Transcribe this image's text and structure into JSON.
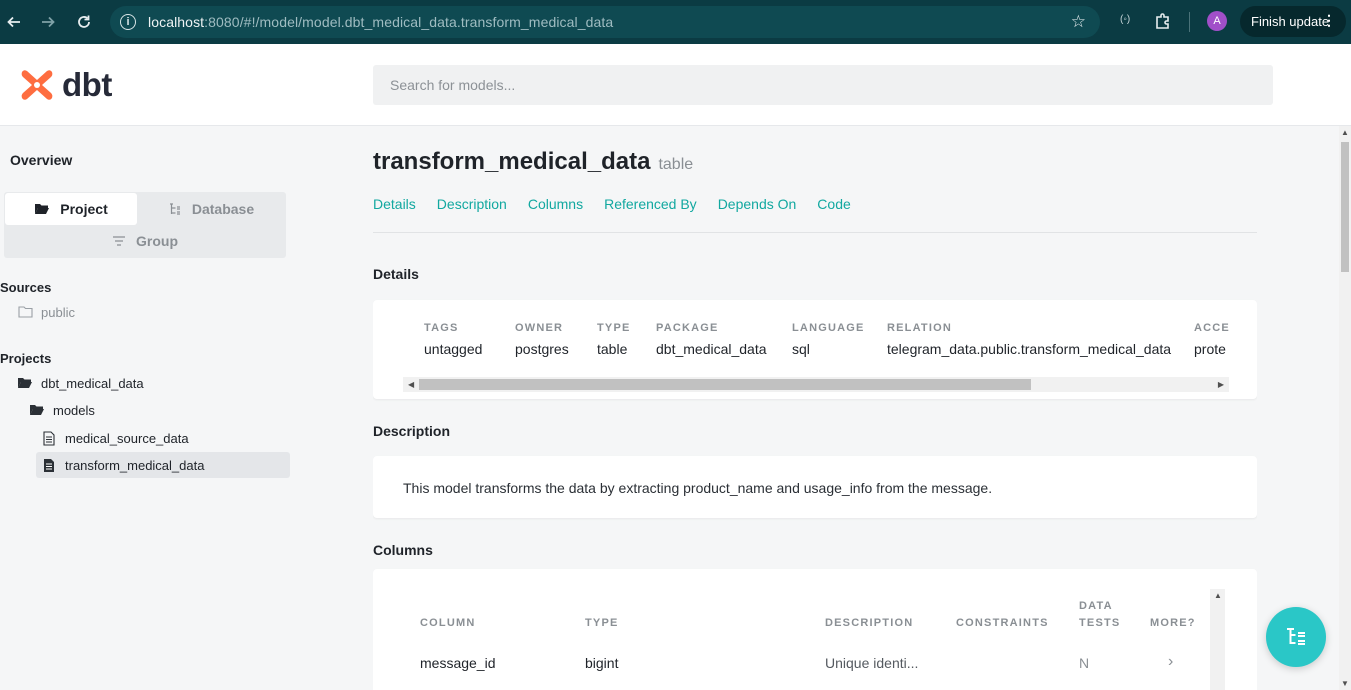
{
  "browser": {
    "url_host": "localhost",
    "url_rest": ":8080/#!/model/model.dbt_medical_data.transform_medical_data",
    "avatar_letter": "A",
    "finish_update_label": "Finish update"
  },
  "header": {
    "logo_text": "dbt",
    "search_placeholder": "Search for models..."
  },
  "sidebar": {
    "overview_label": "Overview",
    "tabs": [
      {
        "label": "Project",
        "active": true
      },
      {
        "label": "Database",
        "active": false
      },
      {
        "label": "Group",
        "active": false
      }
    ],
    "sources_label": "Sources",
    "sources": [
      {
        "label": "public"
      }
    ],
    "projects_label": "Projects",
    "project_tree": [
      {
        "label": "dbt_medical_data",
        "kind": "folder-open"
      },
      {
        "label": "models",
        "kind": "folder-open"
      },
      {
        "label": "medical_source_data",
        "kind": "file"
      },
      {
        "label": "transform_medical_data",
        "kind": "file",
        "selected": true
      }
    ]
  },
  "main": {
    "title": "transform_medical_data",
    "subtitle": "table",
    "nav_links": [
      "Details",
      "Description",
      "Columns",
      "Referenced By",
      "Depends On",
      "Code"
    ],
    "details_heading": "Details",
    "details": [
      {
        "key": "TAGS",
        "value": "untagged"
      },
      {
        "key": "OWNER",
        "value": "postgres"
      },
      {
        "key": "TYPE",
        "value": "table"
      },
      {
        "key": "PACKAGE",
        "value": "dbt_medical_data"
      },
      {
        "key": "LANGUAGE",
        "value": "sql"
      },
      {
        "key": "RELATION",
        "value": "telegram_data.public.transform_medical_data"
      },
      {
        "key": "ACCES",
        "value": "prote"
      }
    ],
    "description_heading": "Description",
    "description_text": "This model transforms the data by extracting product_name and usage_info from the message.",
    "columns_heading": "Columns",
    "columns_headers": [
      "COLUMN",
      "TYPE",
      "DESCRIPTION",
      "CONSTRAINTS",
      "DATA",
      "TESTS",
      "MORE?"
    ],
    "columns_rows": [
      {
        "column": "message_id",
        "type": "bigint",
        "description": "Unique identi...",
        "constraints": "",
        "tests": "N",
        "more": "›"
      }
    ]
  },
  "colors": {
    "chrome": "#0b3b43",
    "accent_link": "#12a8a0",
    "fab": "#2ac7c7",
    "logo_orange": "#fe6d40"
  }
}
